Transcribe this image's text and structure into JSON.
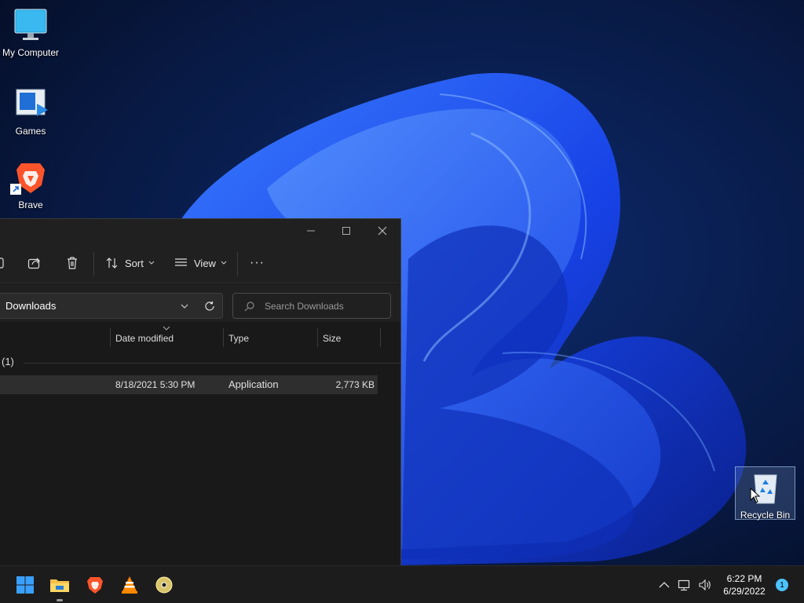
{
  "desktop": {
    "icons": [
      {
        "label": "My Computer"
      },
      {
        "label": "Games"
      },
      {
        "label": "Brave"
      },
      {
        "label": "Recycle Bin"
      }
    ]
  },
  "explorer": {
    "toolbar": {
      "sort_label": "Sort",
      "view_label": "View",
      "more_label": "···"
    },
    "address": {
      "current_folder": "Downloads",
      "search_placeholder": "Search Downloads"
    },
    "columns": [
      "Date modified",
      "Type",
      "Size"
    ],
    "group": {
      "label": "(1)"
    },
    "rows": [
      {
        "date_modified": "8/18/2021 5:30 PM",
        "type": "Application",
        "size": "2,773 KB"
      }
    ]
  },
  "taskbar": {
    "pinned": [
      "start-icon",
      "file-explorer-icon",
      "brave-icon",
      "vlc-icon",
      "disc-icon"
    ],
    "clock": {
      "time": "6:22 PM",
      "date": "6/29/2022"
    },
    "notification_count": "1"
  },
  "colors": {
    "accent": "#4cc2ff",
    "wallpaper_bloom": "#1f49f0",
    "window_bg": "#191919",
    "taskbar_bg": "#1c1c1c"
  }
}
